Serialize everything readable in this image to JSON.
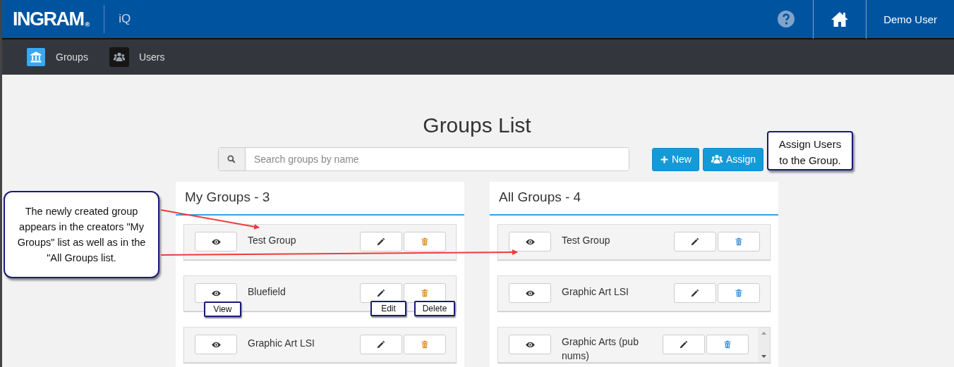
{
  "header": {
    "logo": "INGRAM",
    "logo_mark": "®",
    "app_name": "iQ",
    "user_menu": "Demo User"
  },
  "nav": [
    {
      "label": "Groups",
      "selected": true
    },
    {
      "label": "Users",
      "selected": false
    }
  ],
  "page_title": "Groups List",
  "search": {
    "placeholder": "Search groups by name"
  },
  "buttons": [
    {
      "kind": "new",
      "label": "New"
    },
    {
      "kind": "assign",
      "label": "Assign"
    }
  ],
  "panels": [
    {
      "kind": "mine",
      "title": "My Groups - 3",
      "groups": [
        {
          "name": "Test Group"
        },
        {
          "name": "Bluefield"
        },
        {
          "name": "Graphic Art LSI"
        }
      ]
    },
    {
      "kind": "all",
      "title": "All Groups - 4",
      "groups": [
        {
          "name": "Test Group"
        },
        {
          "name": "Graphic Art LSI"
        },
        {
          "name": "Graphic Arts (pub nums)",
          "scrolling": true
        }
      ]
    }
  ],
  "callouts": [
    {
      "kind": "note",
      "text": "The newly created group appears in the creators \"My Groups\" list as well as in the \"All Groups list."
    },
    {
      "kind": "assign-note",
      "text": "Assign Users to the Group."
    },
    {
      "kind": "view-tag",
      "text": "View"
    },
    {
      "kind": "edit-tag",
      "text": "Edit"
    },
    {
      "kind": "delete-tag",
      "text": "Delete"
    }
  ]
}
